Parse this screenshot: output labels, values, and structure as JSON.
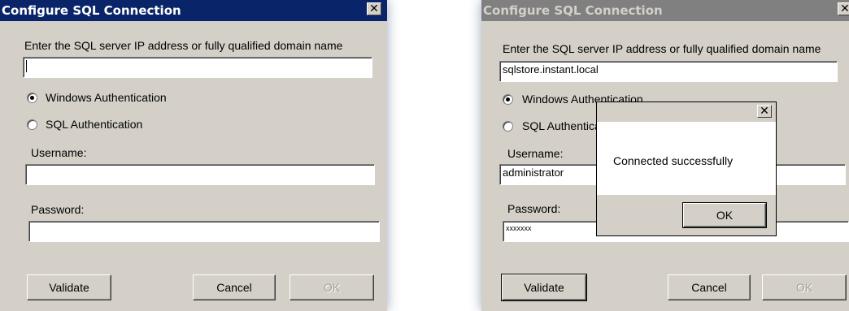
{
  "left_dialog": {
    "title": "Configure SQL Connection",
    "close_glyph": "✕",
    "prompt": "Enter the SQL server IP address or fully qualified domain name",
    "server_value": "",
    "auth_windows_label": "Windows Authentication",
    "auth_sql_label": "SQL Authentication",
    "selected_auth": "Windows Authentication",
    "username_label": "Username:",
    "username_value": "",
    "password_label": "Password:",
    "password_value": "",
    "validate_label": "Validate",
    "cancel_label": "Cancel",
    "ok_label": "OK"
  },
  "right_dialog": {
    "title": "Configure SQL Connection",
    "close_glyph": "✕",
    "prompt": "Enter the SQL server IP address or fully qualified domain name",
    "server_value": "sqlstore.instant.local",
    "auth_windows_label": "Windows Authentication",
    "auth_sql_label": "SQL Authentication",
    "selected_auth": "Windows Authentication",
    "username_label": "Username:",
    "username_value": "administrator",
    "password_label": "Password:",
    "password_value": "xxxxxxx",
    "validate_label": "Validate",
    "cancel_label": "Cancel",
    "ok_label": "OK"
  },
  "message_box": {
    "close_glyph": "✕",
    "message": "Connected successfully",
    "ok_label": "OK"
  }
}
